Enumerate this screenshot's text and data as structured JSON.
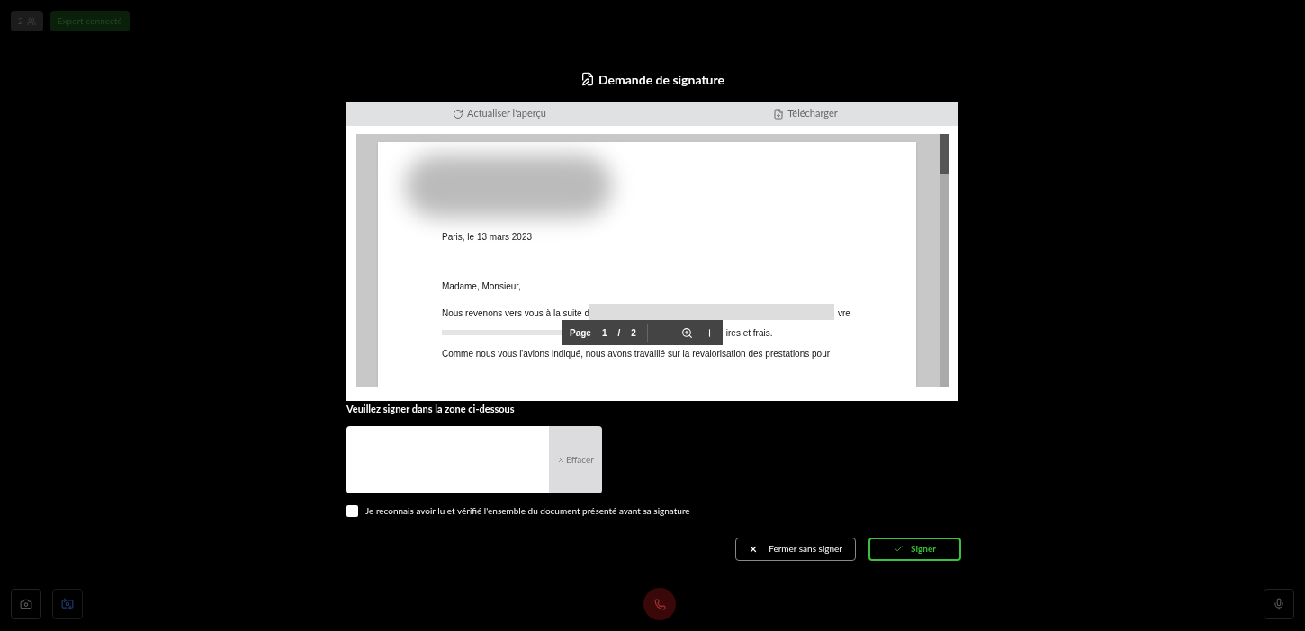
{
  "top_bar": {
    "participants": "2",
    "status": "Expert connecté"
  },
  "dialog": {
    "title": "Demande de signature",
    "toolbar": [
      {
        "kind": "refresh",
        "label": "Actualiser l'aperçu"
      },
      {
        "kind": "download",
        "label": "Télécharger"
      }
    ],
    "document": {
      "date": "Paris, le 13 mars 2023",
      "greeting": "Madame, Monsieur,",
      "line_1_start": "Nous revenons vers vous à la suite d",
      "line_1_end": "vre",
      "line_2_end": "ires et frais.",
      "line_3": "Comme nous vous l'avions indiqué, nous avons travaillé sur la revalorisation des prestations pour",
      "pager": {
        "label": "Page",
        "current": "1",
        "separator": "/",
        "total": "2"
      }
    },
    "signature_prompt": "Veuillez signer dans la zone ci-dessous",
    "clear_button": "Effacer",
    "acknowledgement": {
      "label": "Je reconnais avoir lu et vérifié l'ensemble du document présenté avant sa signature",
      "checked": false
    },
    "buttons": [
      {
        "kind": "close",
        "label": "Fermer sans signer"
      },
      {
        "kind": "sign",
        "label": "Signer"
      }
    ]
  }
}
